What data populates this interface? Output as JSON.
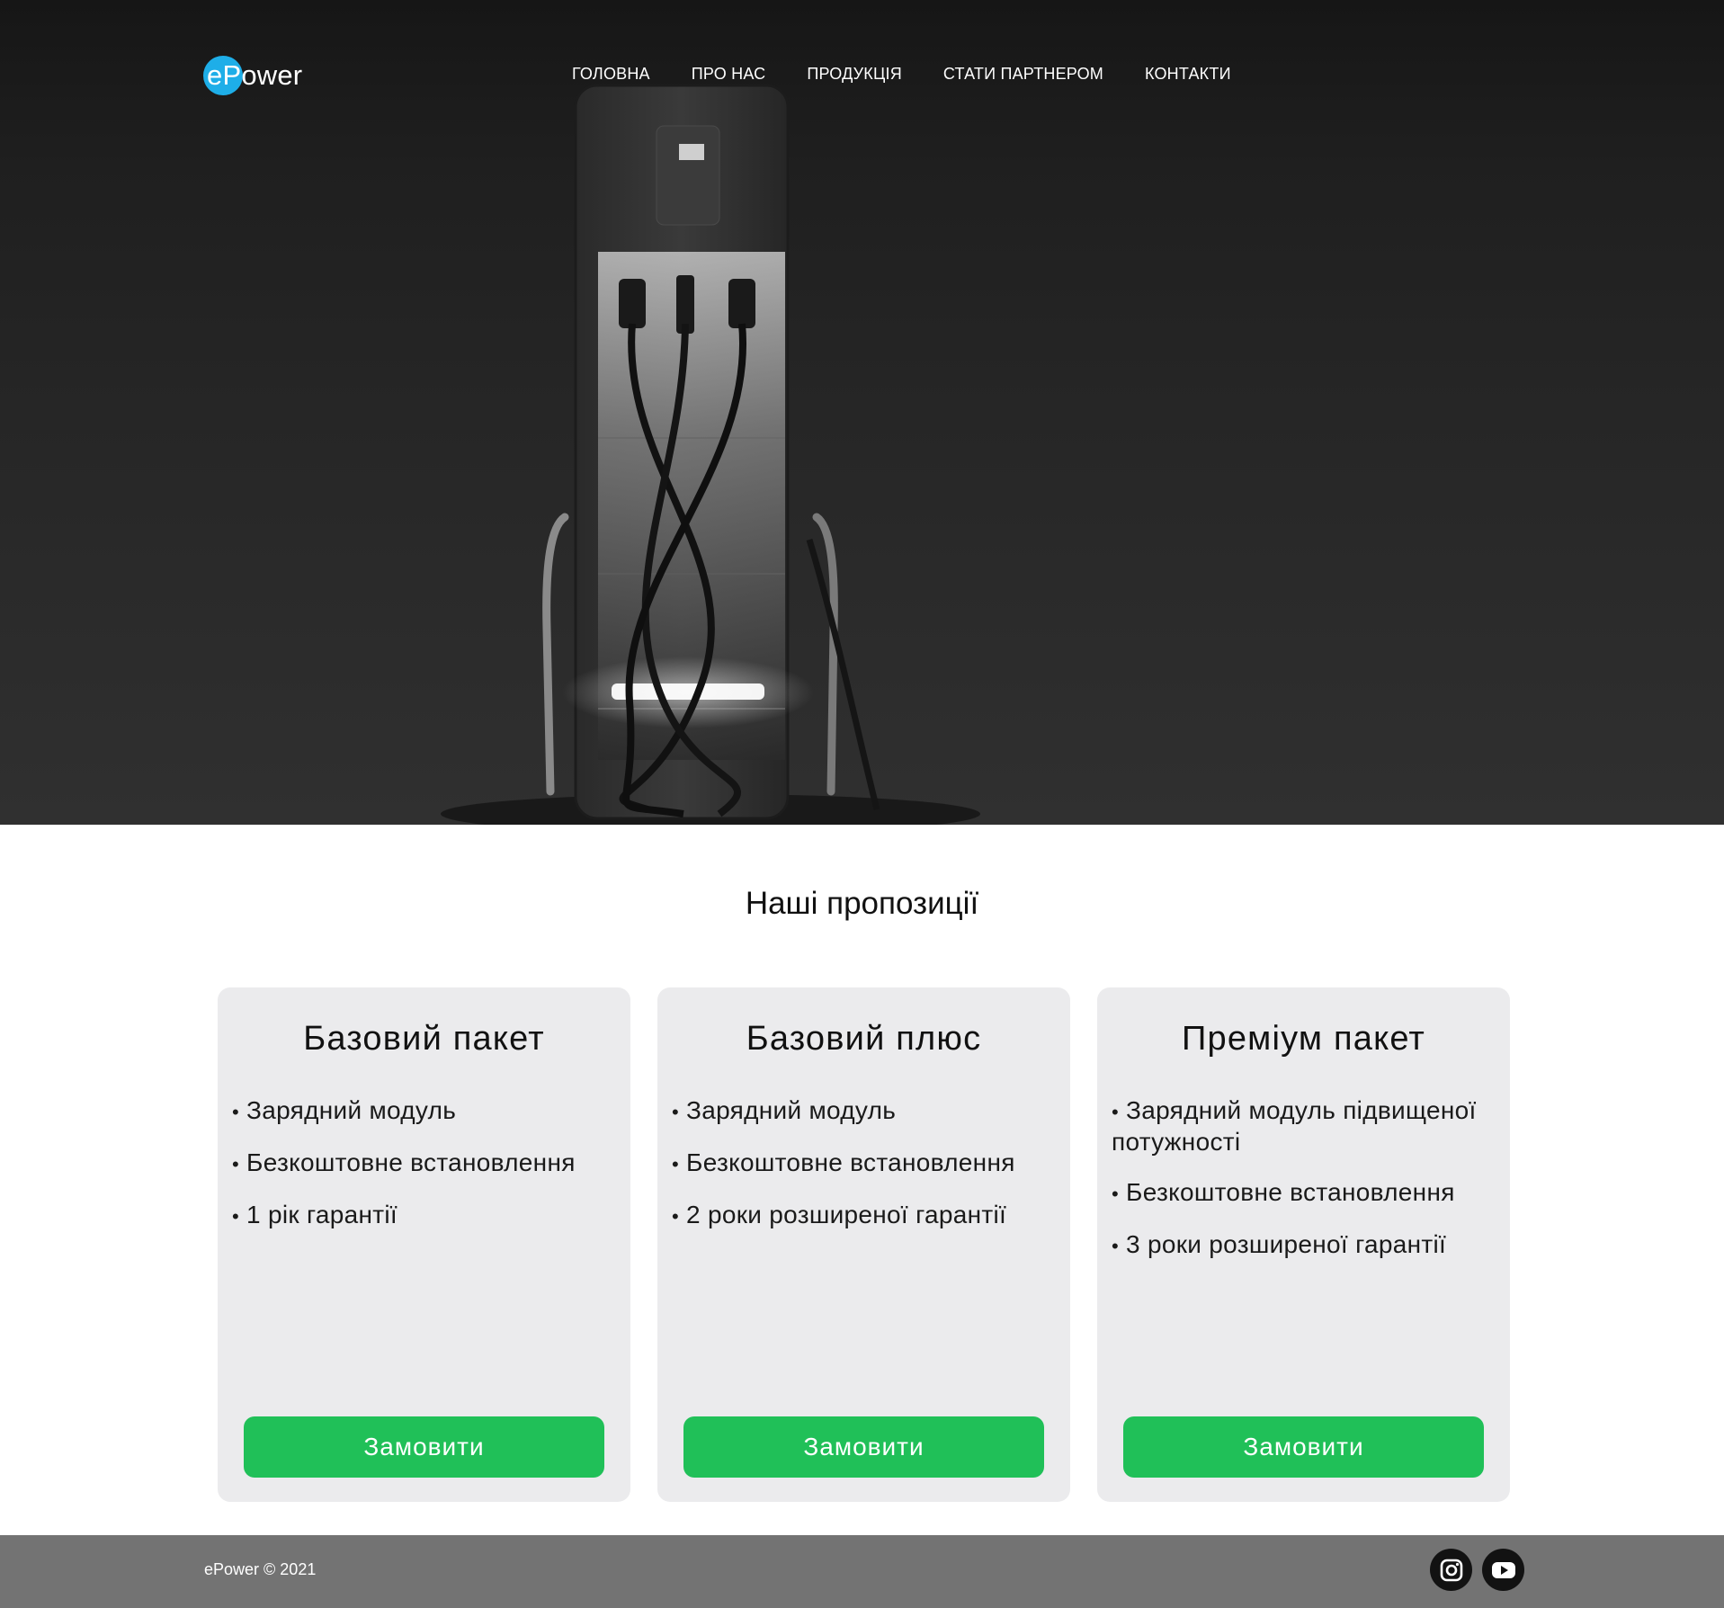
{
  "header": {
    "logo_text": "ePower",
    "nav": [
      {
        "label": "ГОЛОВНА"
      },
      {
        "label": "ПРО НАС"
      },
      {
        "label": "ПРОДУКЦІЯ"
      },
      {
        "label": "СТАТИ ПАРТНЕРОМ"
      },
      {
        "label": "КОНТАКТИ"
      }
    ]
  },
  "offers": {
    "title": "Наші пропозиції",
    "cards": [
      {
        "title": "Базовий пакет",
        "features": [
          "Зарядний модуль",
          "Безкоштовне встановлення",
          "1 рік гарантії"
        ],
        "button": "Замовити"
      },
      {
        "title": "Базовий плюс",
        "features": [
          "Зарядний модуль",
          "Безкоштовне встановлення",
          "2 роки розширеної гарантії"
        ],
        "button": "Замовити"
      },
      {
        "title": "Преміум пакет",
        "features": [
          "Зарядний модуль підвищеної потужності",
          "Безкоштовне встановлення",
          "3 роки розширеної гарантії"
        ],
        "button": "Замовити"
      }
    ]
  },
  "footer": {
    "copyright": "ePower © 2021",
    "socials": [
      {
        "icon": "instagram-icon"
      },
      {
        "icon": "youtube-icon"
      }
    ]
  },
  "colors": {
    "logo_accent": "#1eaee8",
    "button": "#20c058",
    "card_bg": "#ebebed",
    "footer_bg": "#737373"
  }
}
